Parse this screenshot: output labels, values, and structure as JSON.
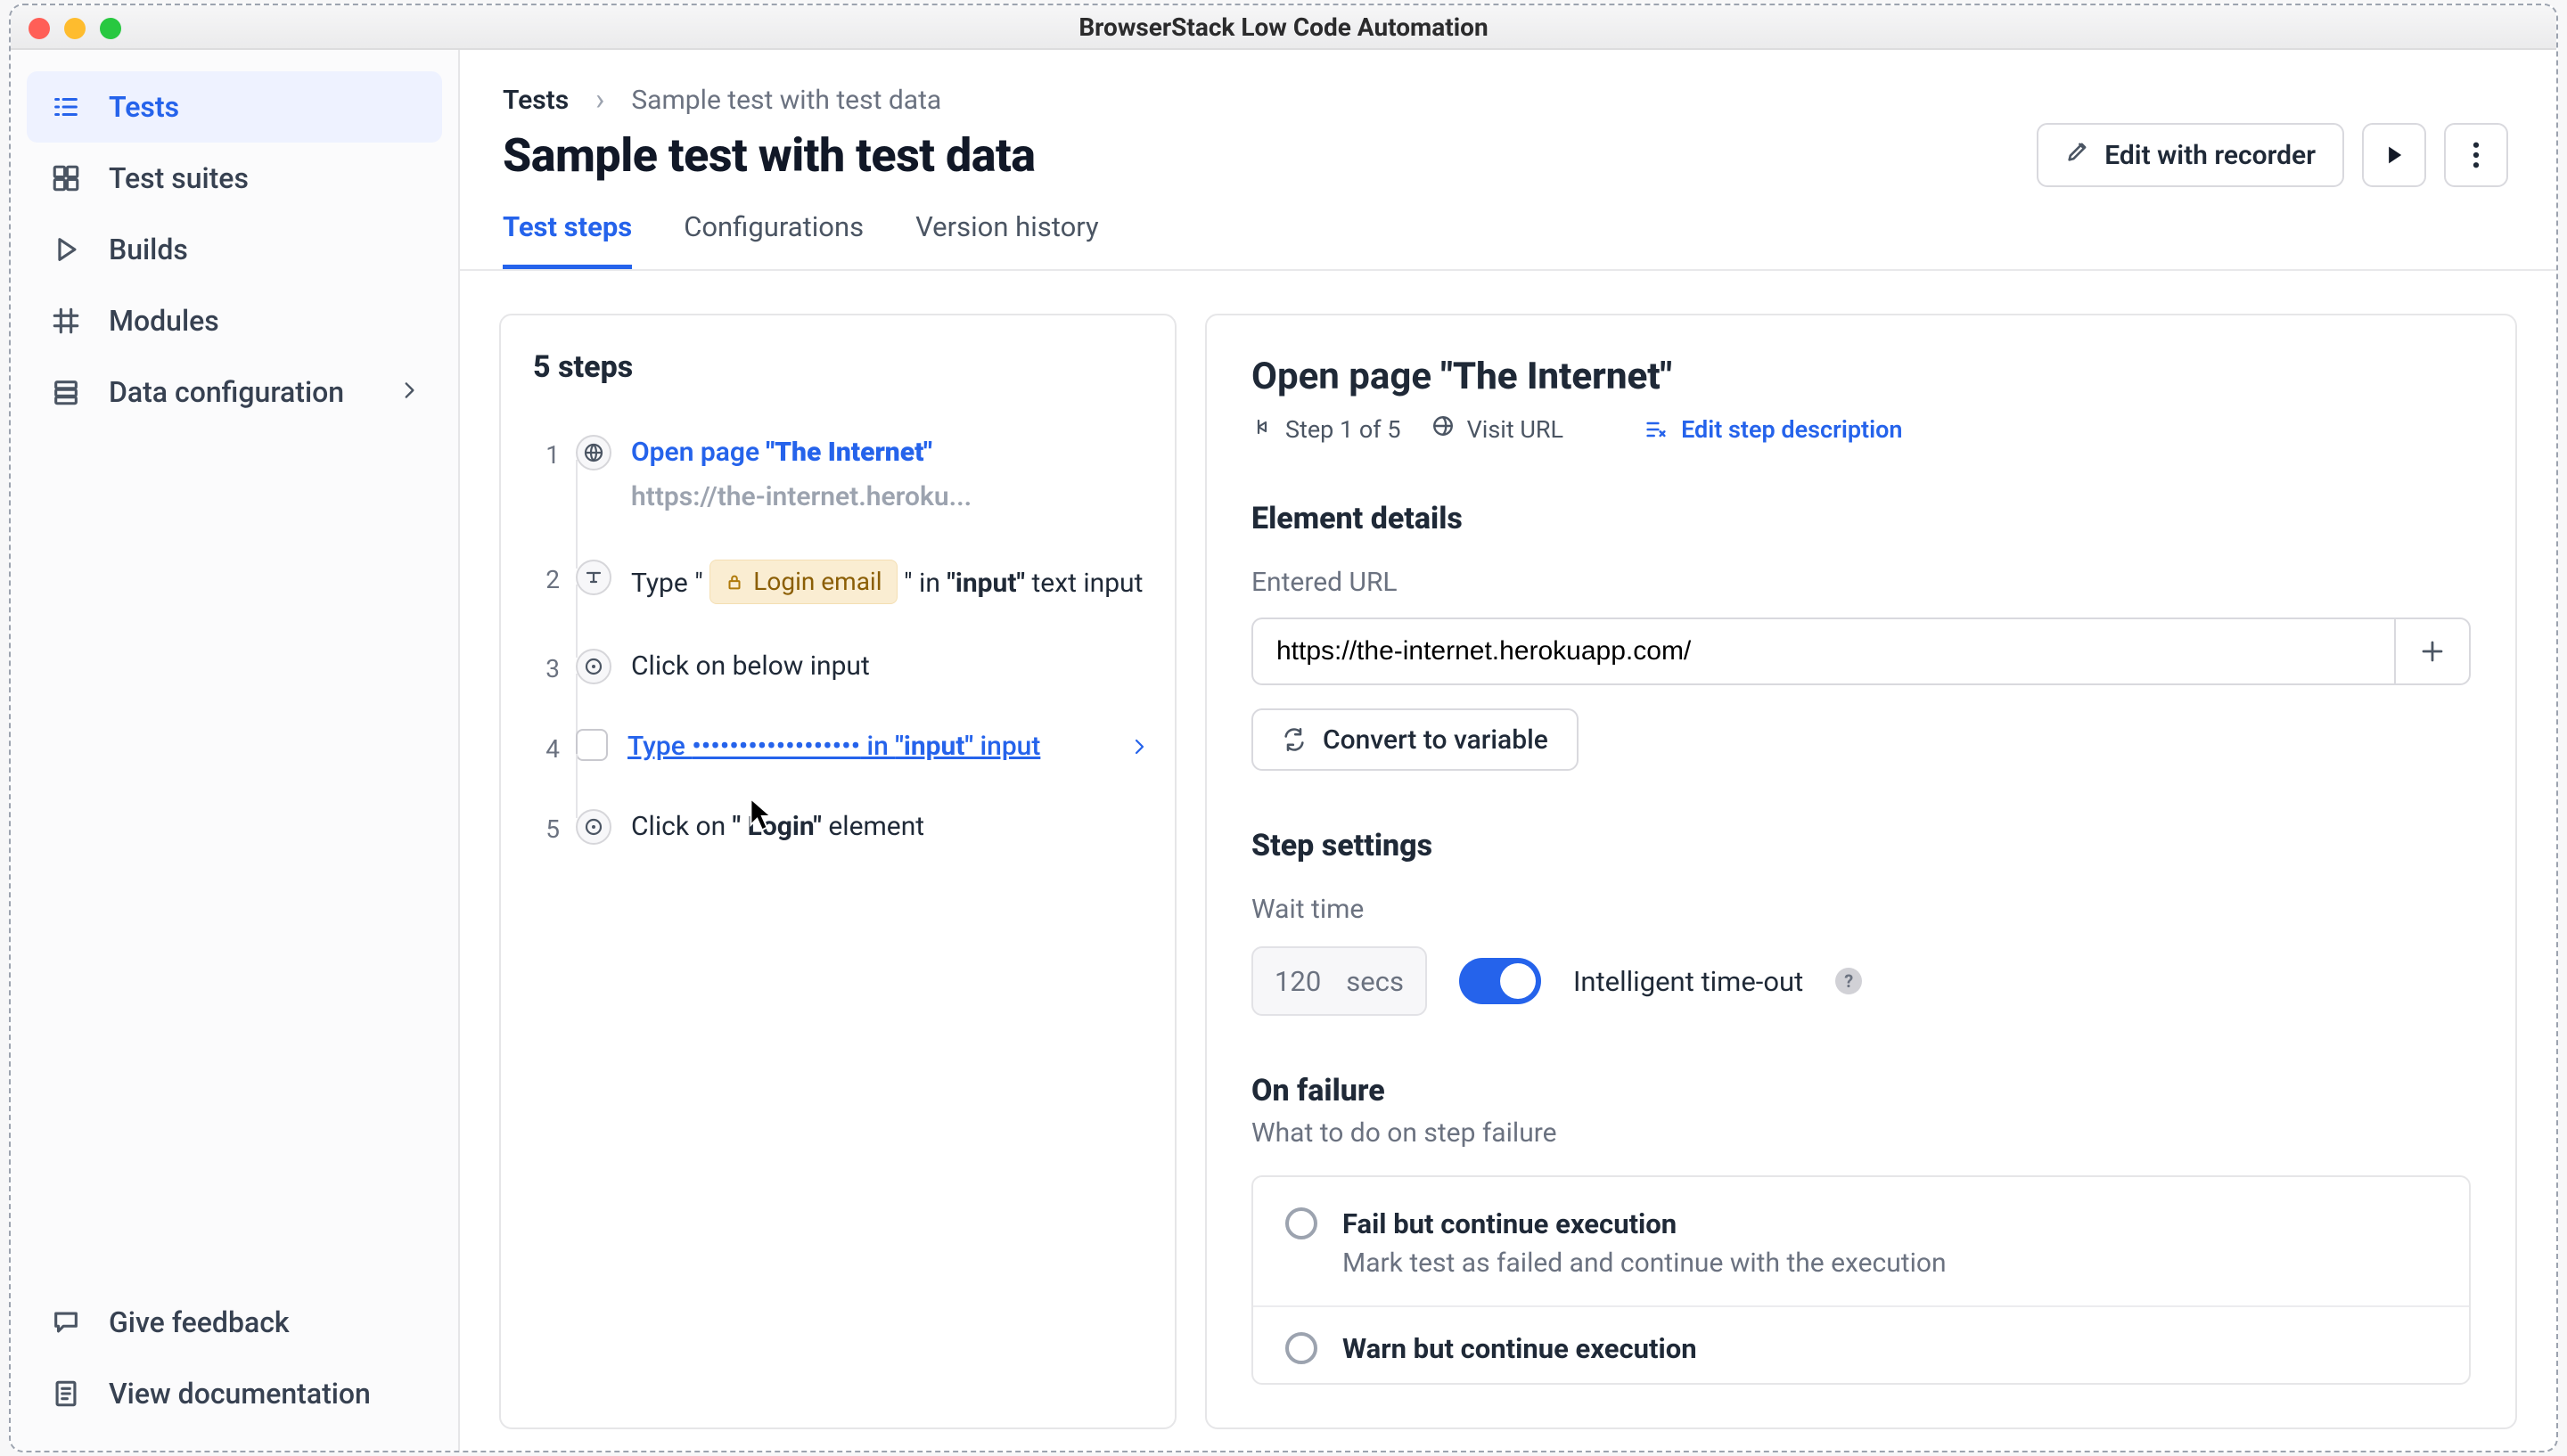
{
  "window": {
    "title": "BrowserStack Low Code Automation"
  },
  "sidebar": {
    "items": [
      {
        "label": "Tests"
      },
      {
        "label": "Test suites"
      },
      {
        "label": "Builds"
      },
      {
        "label": "Modules"
      },
      {
        "label": "Data configuration"
      }
    ],
    "bottom": [
      {
        "label": "Give feedback"
      },
      {
        "label": "View documentation"
      }
    ]
  },
  "breadcrumb": {
    "root": "Tests",
    "sep": "›",
    "current": "Sample test with test data"
  },
  "page": {
    "title": "Sample test with test data"
  },
  "header_actions": {
    "edit": "Edit with recorder"
  },
  "tabs": [
    {
      "label": "Test steps"
    },
    {
      "label": "Configurations"
    },
    {
      "label": "Version history"
    }
  ],
  "steps": {
    "count": "5 steps",
    "items": [
      {
        "num": "1",
        "prefix": "Open page ",
        "bold": "\"The Internet\"",
        "suffix": "",
        "sub": "https://the-internet.heroku..."
      },
      {
        "num": "2",
        "prefix": "Type \" ",
        "chip": "Login email",
        "middle": " \" in ",
        "bold": "\"input\"",
        "suffix": " text input"
      },
      {
        "num": "3",
        "text": "Click on below input"
      },
      {
        "num": "4",
        "prefix": "Type ",
        "dots": "••••••••••••••••••",
        "middle": " in ",
        "bold": "\"input\"",
        "suffix": " input"
      },
      {
        "num": "5",
        "prefix": "Click on ",
        "bold": "\" Login\"",
        "suffix": " element"
      }
    ]
  },
  "detail": {
    "title_prefix": "Open page ",
    "title_bold": "\"The Internet\"",
    "step_pos": "Step 1 of 5",
    "type": "Visit URL",
    "edit": "Edit step description",
    "element_details": "Element details",
    "url_label": "Entered URL",
    "url_value": "https://the-internet.herokuapp.com/",
    "convert": "Convert to variable",
    "step_settings": "Step settings",
    "wait_label": "Wait time",
    "wait_value": "120",
    "wait_unit": "secs",
    "ito": "Intelligent time-out",
    "onfailure": "On failure",
    "onfailure_sub": "What to do on step failure",
    "radios": [
      {
        "title": "Fail but continue execution",
        "desc": "Mark test as failed and continue with the execution"
      },
      {
        "title": "Warn but continue execution"
      }
    ]
  }
}
